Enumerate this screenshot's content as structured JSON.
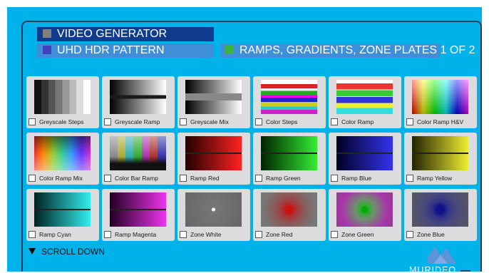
{
  "header": {
    "title": "VIDEO GENERATOR",
    "subtitle": "UHD HDR PATTERN",
    "category": "RAMPS, GRADIENTS, ZONE PLATES  1 OF 2",
    "colors": {
      "title_square": "#808080",
      "subtitle_square": "#4040c0",
      "category_square": "#3cb43c"
    }
  },
  "patterns": [
    {
      "label": "Greyscale Steps",
      "icon": "greyscale-steps-thumbnail"
    },
    {
      "label": "Greyscale Ramp",
      "icon": "greyscale-ramp-thumbnail"
    },
    {
      "label": "Greyscale Mix",
      "icon": "greyscale-mix-thumbnail"
    },
    {
      "label": "Color Steps",
      "icon": "color-steps-thumbnail"
    },
    {
      "label": "Color Ramp",
      "icon": "color-ramp-thumbnail"
    },
    {
      "label": "Color Ramp H&V",
      "icon": "color-ramp-hv-thumbnail"
    },
    {
      "label": "Color Ramp Mix",
      "icon": "color-ramp-mix-thumbnail"
    },
    {
      "label": "Color Bar Ramp",
      "icon": "color-bar-ramp-thumbnail"
    },
    {
      "label": "Ramp Red",
      "icon": "ramp-red-thumbnail"
    },
    {
      "label": "Ramp Green",
      "icon": "ramp-green-thumbnail"
    },
    {
      "label": "Ramp Blue",
      "icon": "ramp-blue-thumbnail"
    },
    {
      "label": "Ramp Yellow",
      "icon": "ramp-yellow-thumbnail"
    },
    {
      "label": "Ramp Cyan",
      "icon": "ramp-cyan-thumbnail"
    },
    {
      "label": "Ramp Magenta",
      "icon": "ramp-magenta-thumbnail"
    },
    {
      "label": "Zone White",
      "icon": "zone-white-thumbnail"
    },
    {
      "label": "Zone Red",
      "icon": "zone-red-thumbnail"
    },
    {
      "label": "Zone Green",
      "icon": "zone-green-thumbnail"
    },
    {
      "label": "Zone Blue",
      "icon": "zone-blue-thumbnail"
    }
  ],
  "scroll": {
    "label": "SCROLL DOWN",
    "icon": "triangle-down-icon"
  },
  "brand": {
    "name": "MURIDEO",
    "icon": "mountain-logo-icon"
  },
  "colors": {
    "background": "#00b1ea",
    "frame": "#1b3d5b",
    "tile": "#dcdcde"
  }
}
